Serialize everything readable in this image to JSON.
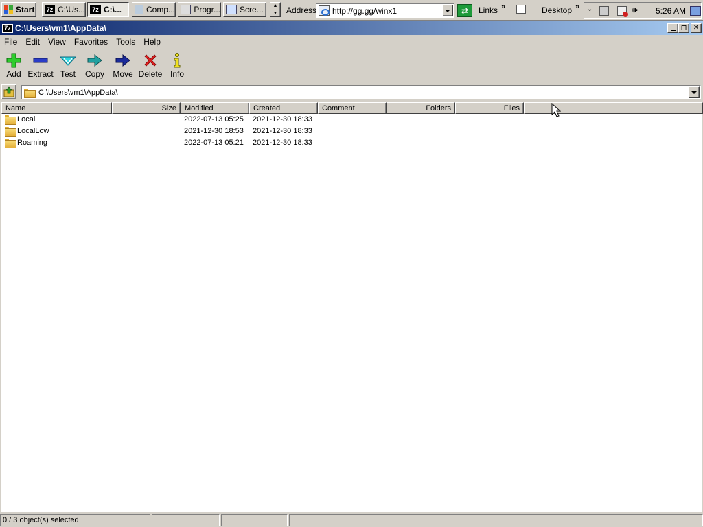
{
  "taskbar": {
    "start_label": "Start",
    "buttons": [
      {
        "label": "C:\\Us..."
      },
      {
        "label": "C:\\..."
      },
      {
        "label": "Comp..."
      },
      {
        "label": "Progr..."
      },
      {
        "label": "Scre..."
      }
    ],
    "address_label": "Address",
    "address_value": "http://gg.gg/winx1",
    "links_label": "Links",
    "desktop_label": "Desktop",
    "clock": "5:26 AM"
  },
  "window": {
    "title": "C:\\Users\\vm1\\AppData\\",
    "menu": [
      "File",
      "Edit",
      "View",
      "Favorites",
      "Tools",
      "Help"
    ],
    "toolbar": [
      {
        "label": "Add",
        "icon": "add-icon"
      },
      {
        "label": "Extract",
        "icon": "extract-icon"
      },
      {
        "label": "Test",
        "icon": "test-icon"
      },
      {
        "label": "Copy",
        "icon": "copy-icon"
      },
      {
        "label": "Move",
        "icon": "move-icon"
      },
      {
        "label": "Delete",
        "icon": "delete-icon"
      },
      {
        "label": "Info",
        "icon": "info-icon"
      }
    ],
    "path": "C:\\Users\\vm1\\AppData\\",
    "columns": [
      "Name",
      "Size",
      "Modified",
      "Created",
      "Comment",
      "Folders",
      "Files"
    ],
    "rows": [
      {
        "name": "Local",
        "size": "",
        "modified": "2022-07-13 05:25",
        "created": "2021-12-30 18:33",
        "comment": "",
        "folders": "",
        "files": ""
      },
      {
        "name": "LocalLow",
        "size": "",
        "modified": "2021-12-30 18:53",
        "created": "2021-12-30 18:33",
        "comment": "",
        "folders": "",
        "files": ""
      },
      {
        "name": "Roaming",
        "size": "",
        "modified": "2022-07-13 05:21",
        "created": "2021-12-30 18:33",
        "comment": "",
        "folders": "",
        "files": ""
      }
    ],
    "status": "0 / 3 object(s) selected",
    "colors": {
      "title_start": "#0a246a",
      "title_end": "#a6caf0",
      "face": "#d4d0c8"
    }
  }
}
